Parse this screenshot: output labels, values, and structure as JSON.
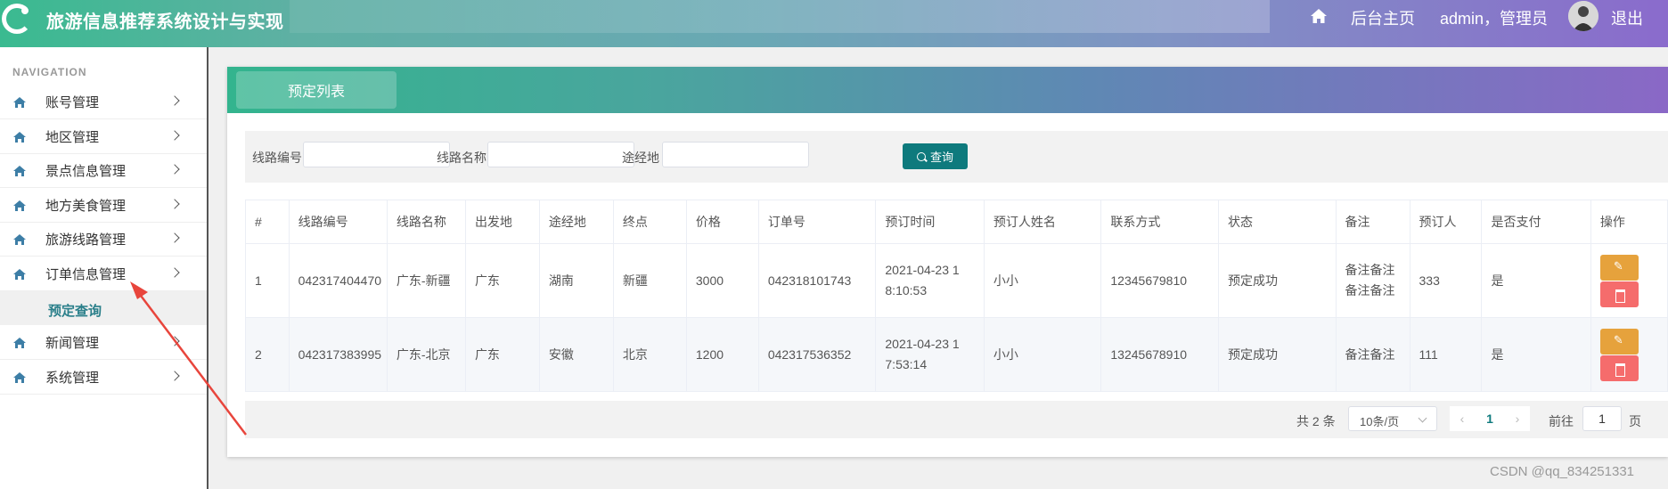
{
  "header": {
    "app_title": "旅游信息推荐系统设计与实现",
    "home_link": "后台主页",
    "user_label": "admin，管理员",
    "logout": "退出"
  },
  "sidebar": {
    "nav_header": "NAVIGATION",
    "items": [
      {
        "label": "账号管理"
      },
      {
        "label": "地区管理"
      },
      {
        "label": "景点信息管理"
      },
      {
        "label": "地方美食管理"
      },
      {
        "label": "旅游线路管理"
      },
      {
        "label": "订单信息管理"
      },
      {
        "label": "新闻管理"
      },
      {
        "label": "系统管理"
      }
    ],
    "sub_item": "预定查询"
  },
  "panel": {
    "tab": "预定列表"
  },
  "search": {
    "route_no_label": "线路编号",
    "route_name_label": "线路名称",
    "via_label": "途经地",
    "button": "查询"
  },
  "table": {
    "headers": [
      "#",
      "线路编号",
      "线路名称",
      "出发地",
      "途经地",
      "终点",
      "价格",
      "订单号",
      "预订时间",
      "预订人姓名",
      "联系方式",
      "状态",
      "备注",
      "预订人",
      "是否支付",
      "操作"
    ],
    "rows": [
      {
        "idx": "1",
        "route_no": "042317404470",
        "route_name": "广东-新疆",
        "from": "广东",
        "via": "湖南",
        "to": "新疆",
        "price": "3000",
        "order_no": "042318101743",
        "time1": "2021-04-23 1",
        "time2": "8:10:53",
        "name": "小小",
        "phone": "12345679810",
        "status": "预定成功",
        "note1": "备注备注",
        "note2": "备注备注",
        "booker": "333",
        "paid": "是"
      },
      {
        "idx": "2",
        "route_no": "042317383995",
        "route_name": "广东-北京",
        "from": "广东",
        "via": "安徽",
        "to": "北京",
        "price": "1200",
        "order_no": "042317536352",
        "time1": "2021-04-23 1",
        "time2": "7:53:14",
        "name": "小小",
        "phone": "13245678910",
        "status": "预定成功",
        "note1": "备注备注",
        "note2": "",
        "booker": "111",
        "paid": "是"
      }
    ]
  },
  "pagination": {
    "total": "共 2 条",
    "page_size": "10条/页",
    "current_page": "1",
    "goto_label": "前往",
    "goto_value": "1",
    "page_suffix": "页"
  },
  "watermark": "CSDN @qq_834251331",
  "colors": {
    "accent": "#0e7a7d",
    "edit": "#e6a23c",
    "delete": "#f56c6c",
    "annotation_arrow": "#e8453c"
  }
}
